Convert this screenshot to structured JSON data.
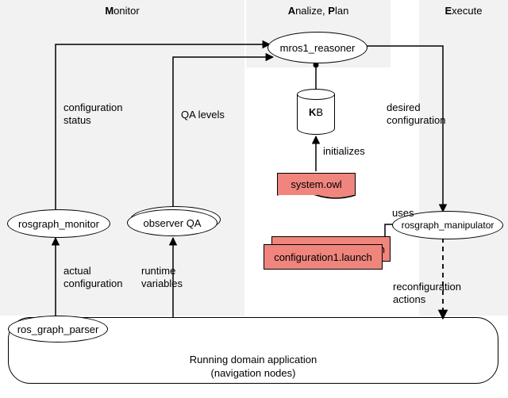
{
  "regions": {
    "monitor": {
      "label_bold": "M",
      "label_rest": "onitor"
    },
    "analize": {
      "label_bold1": "A",
      "label_rest1": "nalize, ",
      "label_bold2": "P",
      "label_rest2": "lan"
    },
    "execute": {
      "label_bold": "E",
      "label_rest": "xecute"
    }
  },
  "nodes": {
    "reasoner": "mros1_reasoner",
    "rosgraph_monitor": "rosgraph_monitor",
    "observer_qa": "observer QA",
    "ros_graph_parser": "ros_graph_parser",
    "rosgraph_manipulator": "rosgraph_manipulator",
    "kb": "B",
    "kb_bold": "K",
    "system_owl": "system.owl",
    "config_launch": "configuration1.launch",
    "app_line1": "Running domain application",
    "app_line2": "(navigation nodes)"
  },
  "edges": {
    "config_status": "configuration\nstatus",
    "qa_levels": "QA levels",
    "desired_config": "desired\nconfiguration",
    "initializes": "initializes",
    "uses": "uses",
    "actual_config": "actual\nconfiguration",
    "runtime_vars": "runtime\nvariables",
    "reconfig_actions": "reconfiguration\nactions"
  }
}
